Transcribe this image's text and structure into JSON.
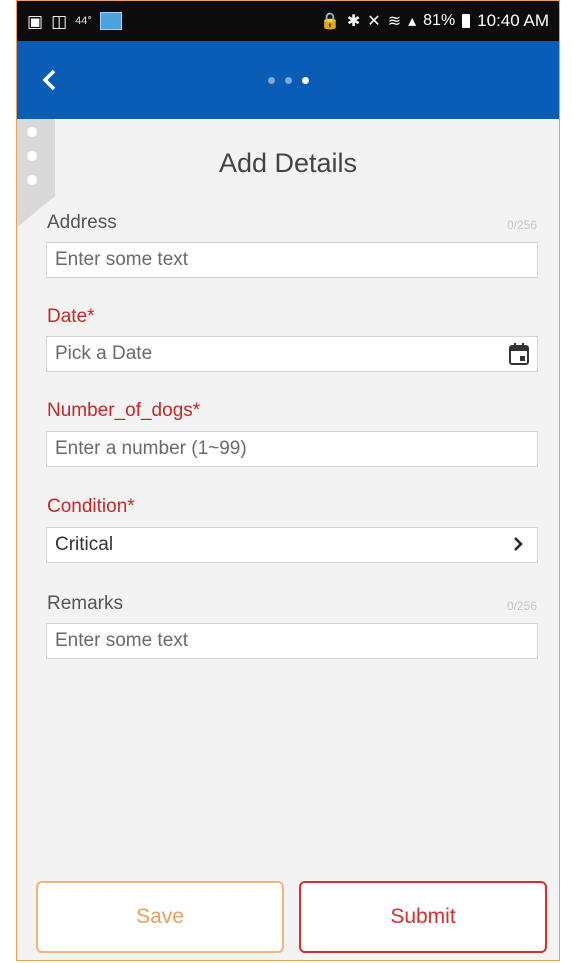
{
  "status_bar": {
    "temperature": "44°",
    "battery": "81%",
    "time": "10:40 AM"
  },
  "app_bar": {
    "back_icon": "chevron-left-icon",
    "page_dots": 3,
    "active_dot": 3
  },
  "form": {
    "title": "Add Details",
    "fields": [
      {
        "label": "Address",
        "required": false,
        "counter": "0/256",
        "placeholder": "Enter some text",
        "value": ""
      },
      {
        "label": "Date*",
        "required": true,
        "placeholder": "Pick a Date",
        "value": "",
        "icon": "calendar-icon"
      },
      {
        "label": "Number_of_dogs*",
        "required": true,
        "placeholder": "Enter a number (1~99)",
        "value": ""
      },
      {
        "label": "Condition*",
        "required": true,
        "value": "Critical",
        "icon": "chevron-right-icon"
      },
      {
        "label": "Remarks",
        "required": false,
        "counter": "0/256",
        "placeholder": "Enter some text",
        "value": ""
      }
    ]
  },
  "actions": {
    "save_label": "Save",
    "submit_label": "Submit"
  },
  "colors": {
    "app_bar": "#0a5db5",
    "required_label": "#c62828",
    "save_border": "#f0b577",
    "submit_border": "#d32f2f"
  }
}
